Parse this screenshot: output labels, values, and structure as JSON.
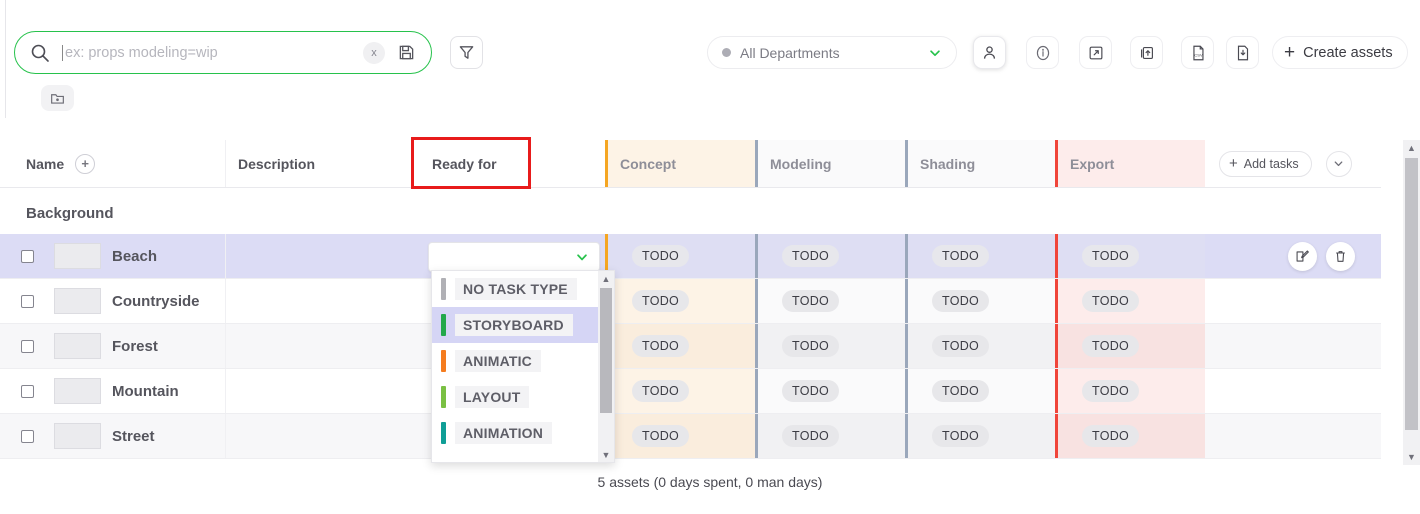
{
  "search": {
    "placeholder": "ex: props modeling=wip",
    "value": "",
    "clear_label": "x",
    "search_icon": "search-icon",
    "save_icon": "save-icon"
  },
  "toolbar": {
    "filter_icon": "filter-icon",
    "folder_icon": "folder-add-icon",
    "department": {
      "label": "All Departments",
      "dot_color": "#adadb5",
      "chevron_color": "#27c24c"
    },
    "buttons": [
      {
        "name": "person-icon",
        "title": "person"
      },
      {
        "name": "info-icon",
        "title": "info"
      },
      {
        "name": "expand-icon",
        "title": "expand"
      },
      {
        "name": "upload-icon",
        "title": "upload"
      },
      {
        "name": "csv-file-icon",
        "title": "csv"
      },
      {
        "name": "download-icon",
        "title": "download"
      }
    ],
    "create_assets": {
      "label": "Create assets",
      "plus": "+"
    }
  },
  "table": {
    "columns": {
      "name": "Name",
      "description": "Description",
      "ready_for": "Ready for",
      "add_tasks": "Add tasks",
      "add_tasks_plus": "+",
      "name_plus": "+"
    },
    "task_columns": [
      {
        "label": "Concept",
        "accent": "#f5a623",
        "tint": "tint-concept"
      },
      {
        "label": "Modeling",
        "accent": "#9aa7bb",
        "tint": "tint-modeling"
      },
      {
        "label": "Shading",
        "accent": "#9aa7bb",
        "tint": "tint-shading"
      },
      {
        "label": "Export",
        "accent": "#f0453a",
        "tint": "tint-export"
      }
    ],
    "highlight_color": "#e81b1b",
    "group_label": "Background",
    "rows": [
      {
        "name": "Beach",
        "status": [
          "TODO",
          "TODO",
          "TODO",
          "TODO"
        ],
        "selected": true
      },
      {
        "name": "Countryside",
        "status": [
          "TODO",
          "TODO",
          "TODO",
          "TODO"
        ],
        "selected": false
      },
      {
        "name": "Forest",
        "status": [
          "TODO",
          "TODO",
          "TODO",
          "TODO"
        ],
        "selected": false
      },
      {
        "name": "Mountain",
        "status": [
          "TODO",
          "TODO",
          "TODO",
          "TODO"
        ],
        "selected": false
      },
      {
        "name": "Street",
        "status": [
          "TODO",
          "TODO",
          "TODO",
          "TODO"
        ],
        "selected": false
      }
    ],
    "row_actions": {
      "edit_icon": "edit-icon",
      "delete_icon": "trash-icon"
    }
  },
  "ready_for_dropdown": {
    "selected_value": "",
    "options": [
      {
        "label": "NO TASK TYPE",
        "color": "#b0b0b5",
        "active": false
      },
      {
        "label": "STORYBOARD",
        "color": "#22a84a",
        "active": true
      },
      {
        "label": "ANIMATIC",
        "color": "#f57c1f",
        "active": false
      },
      {
        "label": "LAYOUT",
        "color": "#7ac043",
        "active": false
      },
      {
        "label": "ANIMATION",
        "color": "#0f9e96",
        "active": false
      },
      {
        "label": "",
        "color": "#ec4899",
        "active": false
      }
    ]
  },
  "footer": {
    "summary": "5 assets (0 days spent, 0 man days)"
  }
}
